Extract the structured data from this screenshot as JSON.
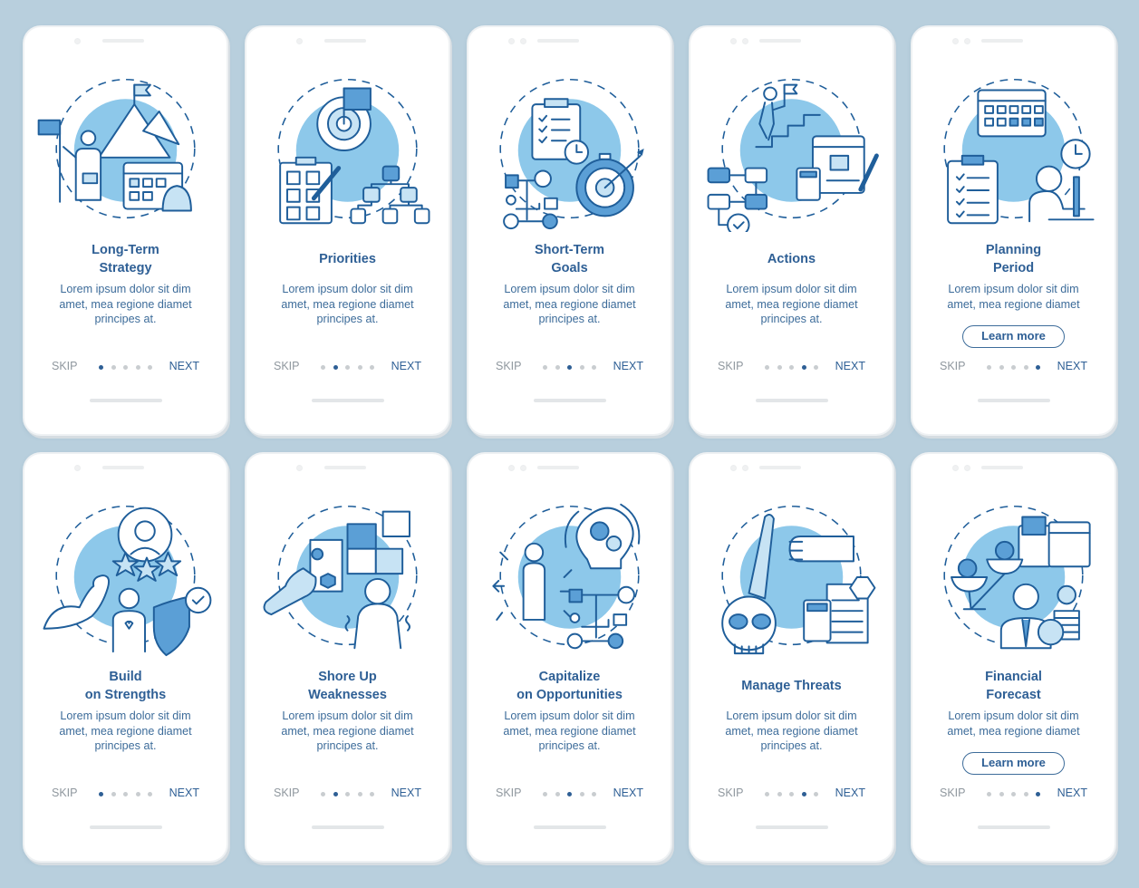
{
  "colors": {
    "background": "#b8cfdd",
    "accent_dark": "#2e5f95",
    "accent_light": "#8dc8ea",
    "body_text": "#3d6c9a",
    "muted": "#8f979e"
  },
  "screens": [
    {
      "title_line1": "Long-Term",
      "title_line2": "Strategy",
      "body_line1": "Lorem ipsum dolor sit dim",
      "body_line2": "amet, mea regione diamet",
      "body_line3": "principes at.",
      "skip": "SKIP",
      "next": "NEXT",
      "active_dot": 1,
      "total_dots": 5,
      "icon": "mountain-flag-calendar-bell-icon",
      "cameras": 1
    },
    {
      "title_line1": "Priorities",
      "title_line2": "",
      "body_line1": "Lorem ipsum dolor sit dim",
      "body_line2": "amet, mea regione diamet",
      "body_line3": "principes at.",
      "skip": "SKIP",
      "next": "NEXT",
      "active_dot": 2,
      "total_dots": 5,
      "icon": "target-checklist-hierarchy-icon",
      "cameras": 1
    },
    {
      "title_line1": "Short-Term",
      "title_line2": "Goals",
      "body_line1": "Lorem ipsum dolor sit dim",
      "body_line2": "amet, mea regione diamet",
      "body_line3": "principes at.",
      "skip": "SKIP",
      "next": "NEXT",
      "active_dot": 3,
      "total_dots": 5,
      "icon": "clipboard-stopwatch-target-icon",
      "cameras": 2
    },
    {
      "title_line1": "Actions",
      "title_line2": "",
      "body_line1": "Lorem ipsum dolor sit dim",
      "body_line2": "amet, mea regione diamet",
      "body_line3": "principes at.",
      "skip": "SKIP",
      "next": "NEXT",
      "active_dot": 4,
      "total_dots": 5,
      "icon": "stairs-flowchart-calculator-icon",
      "cameras": 2
    },
    {
      "title_line1": "Planning",
      "title_line2": "Period",
      "body_line1": "Lorem ipsum dolor sit dim",
      "body_line2": "amet, mea regione diamet",
      "body_line3": "",
      "learn_more": "Learn more",
      "skip": "SKIP",
      "next": "NEXT",
      "active_dot": 5,
      "total_dots": 5,
      "icon": "calendar-clipboard-clock-laptop-icon",
      "cameras": 2
    },
    {
      "title_line1": "Build",
      "title_line2": "on Strengths",
      "body_line1": "Lorem ipsum dolor sit dim",
      "body_line2": "amet, mea regione diamet",
      "body_line3": "principes at.",
      "skip": "SKIP",
      "next": "NEXT",
      "active_dot": 1,
      "total_dots": 5,
      "icon": "muscle-stars-shield-icon",
      "cameras": 1
    },
    {
      "title_line1": "Shore Up",
      "title_line2": "Weaknesses",
      "body_line1": "Lorem ipsum dolor sit dim",
      "body_line2": "amet, mea regione diamet",
      "body_line3": "principes at.",
      "skip": "SKIP",
      "next": "NEXT",
      "active_dot": 2,
      "total_dots": 5,
      "icon": "wrench-puzzle-person-icon",
      "cameras": 1
    },
    {
      "title_line1": "Capitalize",
      "title_line2": "on Opportunities",
      "body_line1": "Lorem ipsum dolor sit dim",
      "body_line2": "amet, mea regione diamet",
      "body_line3": "principes at.",
      "skip": "SKIP",
      "next": "NEXT",
      "active_dot": 3,
      "total_dots": 5,
      "icon": "person-lightbulb-gears-icon",
      "cameras": 2
    },
    {
      "title_line1": "Manage Threats",
      "title_line2": "",
      "body_line1": "Lorem ipsum dolor sit dim",
      "body_line2": "amet, mea regione diamet",
      "body_line3": "principes at.",
      "skip": "SKIP",
      "next": "NEXT",
      "active_dot": 4,
      "total_dots": 5,
      "icon": "hand-fist-skull-document-icon",
      "cameras": 2
    },
    {
      "title_line1": "Financial",
      "title_line2": "Forecast",
      "body_line1": "Lorem ipsum dolor sit dim",
      "body_line2": "amet, mea regione diamet",
      "body_line3": "",
      "learn_more": "Learn more",
      "skip": "SKIP",
      "next": "NEXT",
      "active_dot": 5,
      "total_dots": 5,
      "icon": "scales-wallet-calendar-businessman-icon",
      "cameras": 2
    }
  ]
}
